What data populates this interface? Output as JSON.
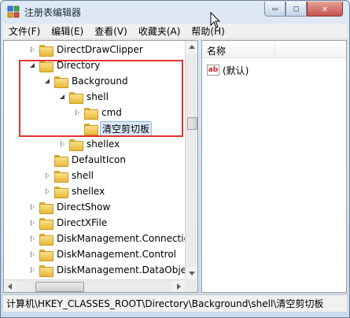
{
  "window": {
    "title": "注册表编辑器"
  },
  "controls": {
    "minimize": "▭",
    "maximize": "□",
    "close": "✕"
  },
  "menu": [
    "文件(F)",
    "编辑(E)",
    "查看(V)",
    "收藏夹(A)",
    "帮助(H)"
  ],
  "tree": [
    {
      "label": "DirectDrawClipper",
      "indent": 1,
      "state": "collapsed"
    },
    {
      "label": "Directory",
      "indent": 1,
      "state": "expanded"
    },
    {
      "label": "Background",
      "indent": 2,
      "state": "expanded"
    },
    {
      "label": "shell",
      "indent": 3,
      "state": "expanded"
    },
    {
      "label": "cmd",
      "indent": 4,
      "state": "collapsed"
    },
    {
      "label": "清空剪切板",
      "indent": 4,
      "state": "none",
      "selected": true
    },
    {
      "label": "shellex",
      "indent": 3,
      "state": "collapsed"
    },
    {
      "label": "DefaultIcon",
      "indent": 2,
      "state": "none"
    },
    {
      "label": "shell",
      "indent": 2,
      "state": "collapsed"
    },
    {
      "label": "shellex",
      "indent": 2,
      "state": "collapsed"
    },
    {
      "label": "DirectShow",
      "indent": 1,
      "state": "collapsed"
    },
    {
      "label": "DirectXFile",
      "indent": 1,
      "state": "collapsed"
    },
    {
      "label": "DiskManagement.Connection",
      "indent": 1,
      "state": "collapsed"
    },
    {
      "label": "DiskManagement.Control",
      "indent": 1,
      "state": "collapsed"
    },
    {
      "label": "DiskManagement.DataObject",
      "indent": 1,
      "state": "collapsed"
    }
  ],
  "list": {
    "column_name": "名称",
    "rows": [
      {
        "icon": "ab",
        "name": "(默认)"
      }
    ]
  },
  "status": {
    "path": "计算机\\HKEY_CLASSES_ROOT\\Directory\\Background\\shell\\清空剪切板"
  },
  "colors": {
    "highlight_box": "#e0332f",
    "selection": "#dbe9f8"
  }
}
